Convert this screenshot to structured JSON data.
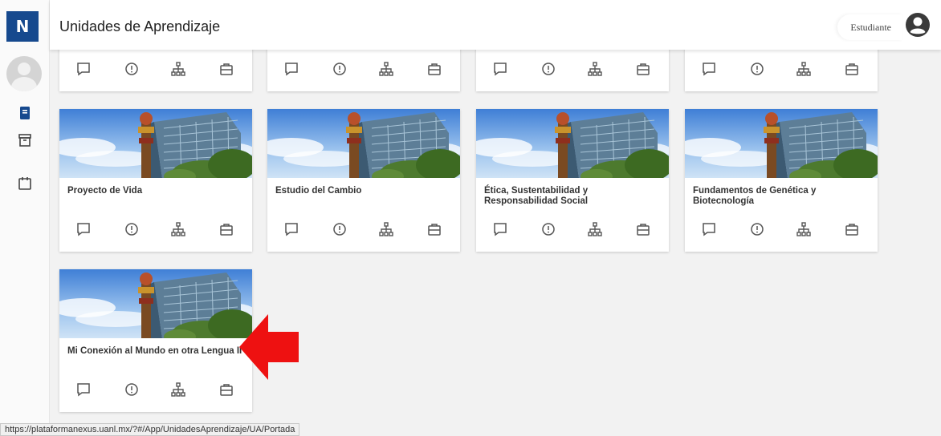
{
  "app": {
    "logo_letter": "N"
  },
  "header": {
    "title": "Unidades de Aprendizaje",
    "role": "Estudiante"
  },
  "sidebar": {
    "items": [
      {
        "icon": "book-icon",
        "active": true
      },
      {
        "icon": "archive-icon",
        "active": false
      },
      {
        "icon": "calendar-icon",
        "active": false
      }
    ]
  },
  "cards": [
    {
      "title": "Proyecto de Vida"
    },
    {
      "title": "Estudio del Cambio"
    },
    {
      "title": "Ética, Sustentabilidad y Responsabilidad Social"
    },
    {
      "title": "Fundamentos de Genética y Biotecnología"
    },
    {
      "title": "Mi Conexión al Mundo en otra Lengua II"
    }
  ],
  "card_actions": [
    "chat-icon",
    "info-icon",
    "hierarchy-icon",
    "briefcase-icon"
  ],
  "status_bar": {
    "url": "https://plataformanexus.uanl.mx/?#/App/UnidadesAprendizaje/UA/Portada"
  },
  "colors": {
    "brand": "#16498e",
    "annotation_arrow": "#ee1111",
    "icon": "#555555"
  }
}
